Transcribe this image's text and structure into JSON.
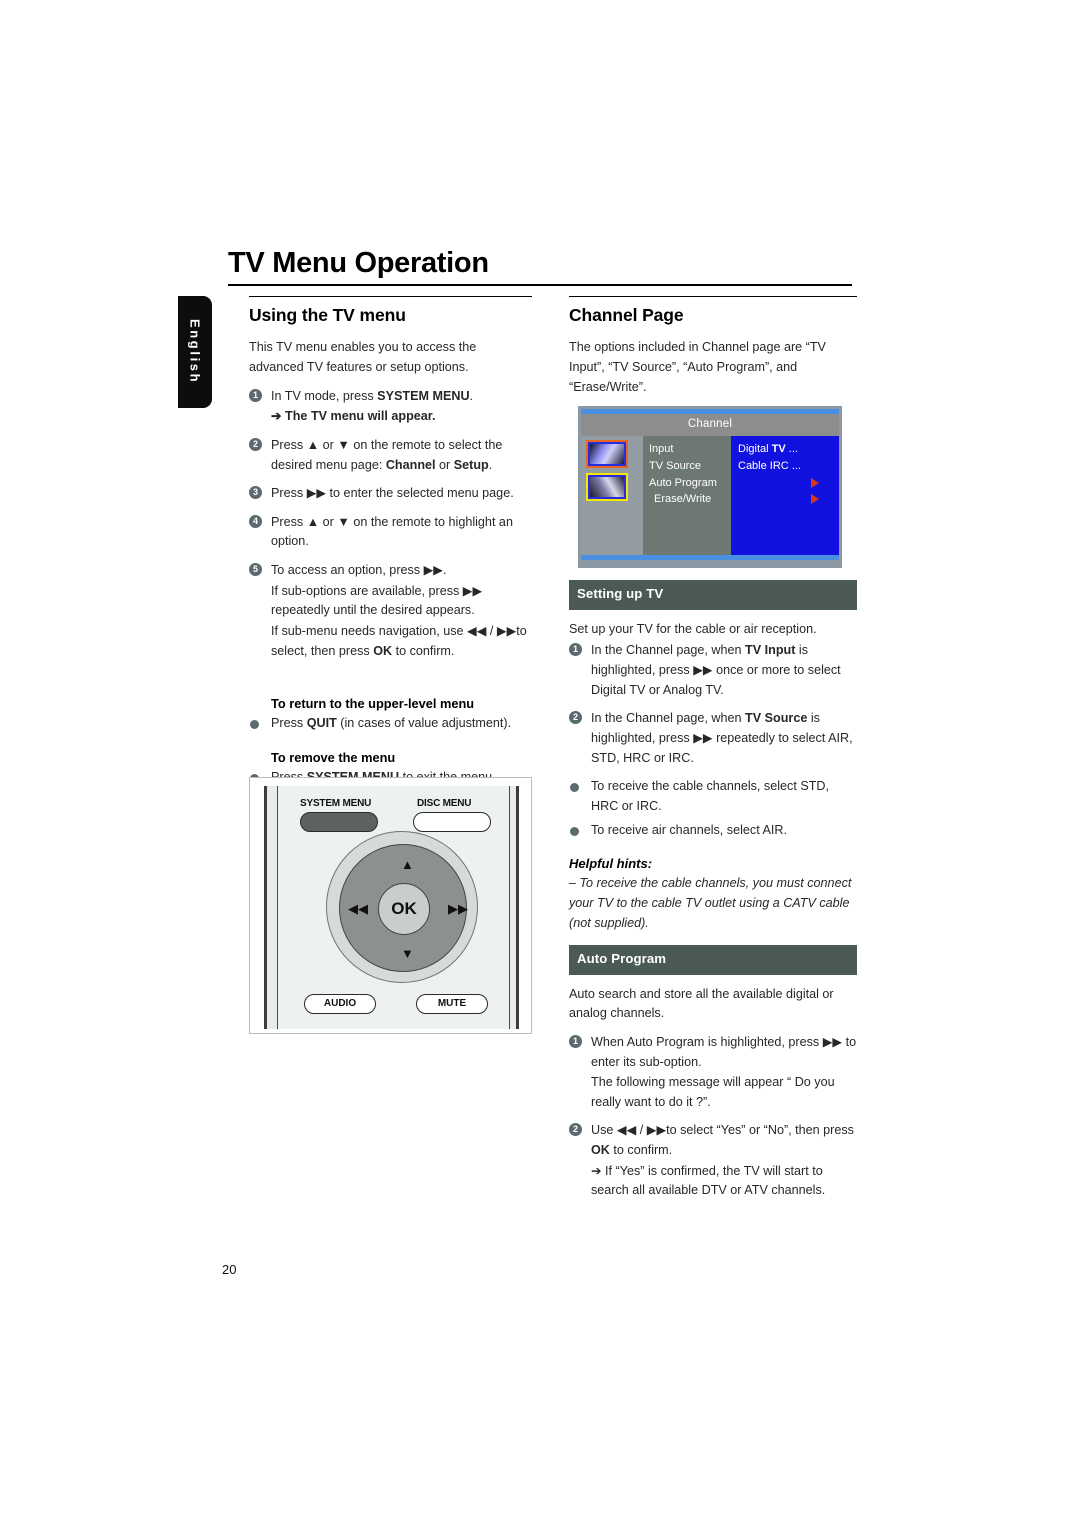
{
  "page": {
    "title": "TV Menu Operation",
    "language_tab": "English",
    "page_number": "20"
  },
  "left_column": {
    "section_title": "Using the TV menu",
    "intro": "This TV menu enables you to access the advanced TV features or setup options.",
    "steps": [
      {
        "num": "1",
        "text_before": "In TV mode, press ",
        "bold": "SYSTEM MENU",
        "text_after": ".",
        "sub": "➔ The TV menu will appear."
      },
      {
        "num": "2",
        "text_before": "Press ▲ or ▼  on the remote to select the desired menu page: ",
        "bold": "Channel",
        "text_mid": " or ",
        "bold2": "Setup",
        "text_after": ".",
        "sub": ""
      },
      {
        "num": "3",
        "text_before": "Press ▶▶  to enter the selected menu page.",
        "bold": "",
        "text_after": "",
        "sub": ""
      },
      {
        "num": "4",
        "text_before": "Press ▲ or ▼ on the remote to highlight an option.",
        "bold": "",
        "text_after": "",
        "sub": ""
      },
      {
        "num": "5",
        "text_before": "To access an option, press ▶▶.",
        "bold": "",
        "text_after": "",
        "sub": "If sub-options are available, press ▶▶  repeatedly until the desired appears."
      }
    ],
    "step5_extra_before": "If sub-menu needs navigation, use ◀◀ /   ▶▶to select, then press ",
    "step5_extra_bold": "OK",
    "step5_extra_after": " to confirm.",
    "upper_level_heading": "To return to the upper-level menu",
    "upper_level_before": "Press ",
    "upper_level_bold": "QUIT",
    "upper_level_after": " (in cases of value adjustment).",
    "remove_menu_heading": "To remove the menu",
    "remove_menu_before": "Press ",
    "remove_menu_bold": "SYSTEM MENU",
    "remove_menu_after": " to exit the menu."
  },
  "remote": {
    "system_menu_label": "SYSTEM MENU",
    "disc_menu_label": "DISC MENU",
    "ok_label": "OK",
    "audio_label": "AUDIO",
    "mute_label": "MUTE",
    "up_glyph": "▲",
    "down_glyph": "▼",
    "left_glyph": "◀◀",
    "right_glyph": "▶▶"
  },
  "right_column": {
    "section_title": "Channel Page",
    "intro": "The options included in Channel page are “TV Input”, “TV Source”, “Auto Program”,  and “Erase/Write”.",
    "tv_screenshot": {
      "title": "Channel",
      "menu_items": [
        "Input",
        "TV Source",
        "Auto Program",
        "Erase/Write"
      ],
      "values": [
        {
          "label": "Digital",
          "bold": "TV",
          "dots": "..."
        },
        {
          "label": "Cable IRC",
          "bold": "",
          "dots": "..."
        }
      ]
    },
    "setting_up_tv": {
      "band_label": "Setting up TV",
      "intro": "Set up your TV for the cable or air reception.",
      "steps": [
        {
          "num": "1",
          "before": "In the Channel page, when ",
          "bold": "TV Input",
          "after": " is highlighted, press ▶▶  once or more to select Digital TV or Analog TV."
        },
        {
          "num": "2",
          "before": "In the Channel page, when ",
          "bold": "TV Source",
          "after": " is highlighted, press ▶▶  repeatedly to select AIR, STD, HRC or IRC."
        }
      ],
      "bullets": [
        "To receive the cable channels, select STD, HRC or IRC.",
        "To receive air channels, select AIR."
      ]
    },
    "helpful_hints": {
      "title": "Helpful hints:",
      "body": "–  To receive the cable channels,  you must connect your TV to the cable TV outlet using a CATV cable (not supplied)."
    },
    "auto_program": {
      "band_label": "Auto Program",
      "intro": "Auto search and store all the available digital or analog channels.",
      "steps": [
        {
          "num": "1",
          "before": "When Auto Program is highlighted, press ▶▶  to enter its sub-option.",
          "bold": "",
          "after": "",
          "sub": "The following message will appear “ Do you really want to do it ?”."
        },
        {
          "num": "2",
          "before": "Use ◀◀ /   ▶▶to select “Yes” or “No”, then press ",
          "bold": "OK",
          "after": " to confirm.",
          "sub": "➔ If “Yes” is confirmed, the TV will start to search all available DTV or ATV channels."
        }
      ]
    }
  },
  "colors": {
    "band_bg": "#4c5a57",
    "badge_bg": "#5b6a6e",
    "tv_blue": "#1212e0",
    "tv_topline": "#4a90e2",
    "accent_orange": "#e8671f"
  }
}
